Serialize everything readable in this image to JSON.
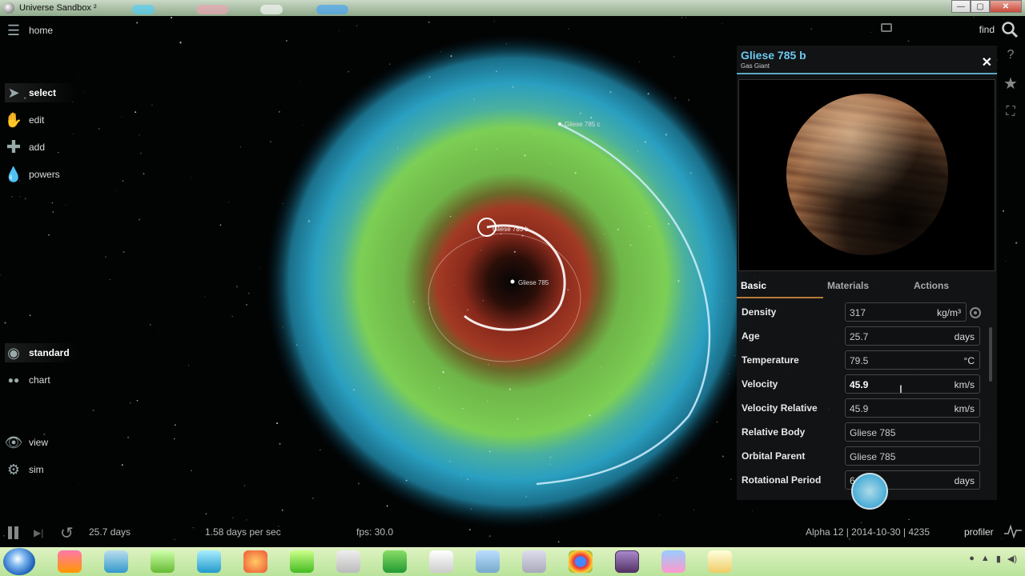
{
  "window": {
    "title": "Universe Sandbox ²",
    "min": "—",
    "max": "▢",
    "close": "✕"
  },
  "menu": {
    "home": "home",
    "select": "select",
    "edit": "edit",
    "add": "add",
    "powers": "powers",
    "standard": "standard",
    "chart": "chart",
    "view": "view",
    "sim": "sim"
  },
  "top": {
    "find": "find"
  },
  "scene": {
    "planet_label": "Gliese 785 b",
    "star_label": "Gliese 785",
    "outer_label": "Gliese 785 c"
  },
  "panel": {
    "title": "Gliese 785 b",
    "subtitle": "Gas Giant",
    "close": "✕",
    "tabs": [
      "Basic",
      "Materials",
      "Actions"
    ],
    "properties": [
      {
        "label": "Density",
        "value": "317",
        "unit": "kg/m³"
      },
      {
        "label": "Age",
        "value": "25.7",
        "unit": "days"
      },
      {
        "label": "Temperature",
        "value": "79.5",
        "unit": "°C"
      },
      {
        "label": "Velocity",
        "value": "45.9",
        "unit": "km/s"
      },
      {
        "label": "Velocity Relative",
        "value": "45.9",
        "unit": "km/s"
      },
      {
        "label": "Relative Body",
        "value": "Gliese 785",
        "unit": ""
      },
      {
        "label": "Orbital Parent",
        "value": "Gliese 785",
        "unit": ""
      },
      {
        "label": "Rotational Period",
        "value": "6",
        "unit": "days"
      }
    ]
  },
  "status": {
    "time": "25.7 days",
    "speed": "1.58 days per sec",
    "fps": "fps: 30.0",
    "version": "Alpha 12  |  2014-10-30  |  4235",
    "profiler": "profiler"
  }
}
